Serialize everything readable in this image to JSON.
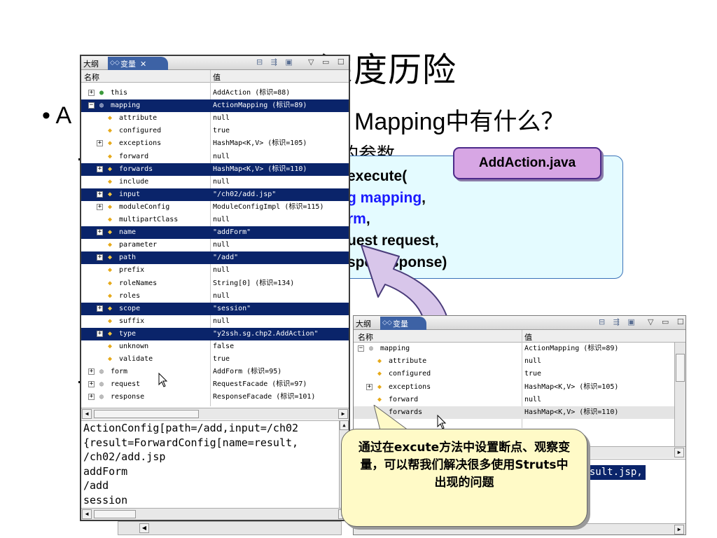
{
  "slide": {
    "title": "Struts深度历险",
    "bullet_prefix": "A",
    "bullet_tail": "Mapping中有什么？",
    "sub_fragment": "的参数",
    "code_filename": "AddAction.java",
    "code_lines": [
      {
        "text": "execute(",
        "blue": "",
        "after": ""
      },
      {
        "text": "",
        "blue": "g mapping",
        "after": ","
      },
      {
        "text": "",
        "blue": "rm",
        "after": ","
      },
      {
        "text": "uest request,",
        "blue": "",
        "after": ""
      },
      {
        "text": "sp",
        "blue": "",
        "after": "e response)"
      }
    ],
    "callout_text": "通过在excute方法中设置断点、观察变量，可以帮我们解决很多使用Struts中出现的问题"
  },
  "panel_main": {
    "tab_outline": "大纲",
    "tab_variables": "变量",
    "tab_close": "✕",
    "col_name": "名称",
    "col_value": "值",
    "rows": [
      {
        "exp": "+",
        "icon": "●",
        "icon_color": "green",
        "name": "this",
        "value": "AddAction  (标识=88)",
        "depth": 0,
        "sel": false
      },
      {
        "exp": "−",
        "icon": "◍",
        "icon_color": "grey",
        "name": "mapping",
        "value": "ActionMapping  (标识=89)",
        "depth": 0,
        "sel": true
      },
      {
        "exp": "",
        "icon": "◆",
        "icon_color": "dia",
        "name": "attribute",
        "value": "null",
        "depth": 2,
        "sel": false
      },
      {
        "exp": "",
        "icon": "◆",
        "icon_color": "dia",
        "name": "configured",
        "value": "true",
        "depth": 2,
        "sel": false
      },
      {
        "exp": "+",
        "icon": "◆",
        "icon_color": "dia",
        "name": "exceptions",
        "value": "HashMap<K,V>  (标识=105)",
        "depth": 1,
        "sel": false
      },
      {
        "exp": "",
        "icon": "◆",
        "icon_color": "dia",
        "name": "forward",
        "value": "null",
        "depth": 2,
        "sel": false
      },
      {
        "exp": "+",
        "icon": "◆",
        "icon_color": "dia",
        "name": "forwards",
        "value": "HashMap<K,V>  (标识=110)",
        "depth": 1,
        "sel": true
      },
      {
        "exp": "",
        "icon": "◆",
        "icon_color": "dia",
        "name": "include",
        "value": "null",
        "depth": 2,
        "sel": false
      },
      {
        "exp": "+",
        "icon": "◆",
        "icon_color": "dia",
        "name": "input",
        "value": "\"/ch02/add.jsp\"",
        "depth": 1,
        "sel": true
      },
      {
        "exp": "+",
        "icon": "◆",
        "icon_color": "dia",
        "name": "moduleConfig",
        "value": "ModuleConfigImpl  (标识=115)",
        "depth": 1,
        "sel": false
      },
      {
        "exp": "",
        "icon": "◆",
        "icon_color": "dia",
        "name": "multipartClass",
        "value": "null",
        "depth": 2,
        "sel": false
      },
      {
        "exp": "+",
        "icon": "◆",
        "icon_color": "dia",
        "name": "name",
        "value": "\"addForm\"",
        "depth": 1,
        "sel": true
      },
      {
        "exp": "",
        "icon": "◆",
        "icon_color": "dia",
        "name": "parameter",
        "value": "null",
        "depth": 2,
        "sel": false
      },
      {
        "exp": "+",
        "icon": "◆",
        "icon_color": "dia",
        "name": "path",
        "value": "\"/add\"",
        "depth": 1,
        "sel": true
      },
      {
        "exp": "",
        "icon": "◆",
        "icon_color": "dia",
        "name": "prefix",
        "value": "null",
        "depth": 2,
        "sel": false
      },
      {
        "exp": "",
        "icon": "◆",
        "icon_color": "dia",
        "name": "roleNames",
        "value": "String[0]  (标识=134)",
        "depth": 2,
        "sel": false
      },
      {
        "exp": "",
        "icon": "◆",
        "icon_color": "dia",
        "name": "roles",
        "value": "null",
        "depth": 2,
        "sel": false
      },
      {
        "exp": "+",
        "icon": "◆",
        "icon_color": "dia",
        "name": "scope",
        "value": "\"session\"",
        "depth": 1,
        "sel": true
      },
      {
        "exp": "",
        "icon": "◆",
        "icon_color": "dia",
        "name": "suffix",
        "value": "null",
        "depth": 2,
        "sel": false
      },
      {
        "exp": "+",
        "icon": "◆",
        "icon_color": "dia",
        "name": "type",
        "value": "\"y2ssh.sg.chp2.AddAction\"",
        "depth": 1,
        "sel": true
      },
      {
        "exp": "",
        "icon": "◆",
        "icon_color": "dia",
        "name": "unknown",
        "value": "false",
        "depth": 2,
        "sel": false
      },
      {
        "exp": "",
        "icon": "◆",
        "icon_color": "dia",
        "name": "validate",
        "value": "true",
        "depth": 2,
        "sel": false
      },
      {
        "exp": "+",
        "icon": "◍",
        "icon_color": "grey",
        "name": "form",
        "value": "AddForm  (标识=95)",
        "depth": 0,
        "sel": false
      },
      {
        "exp": "+",
        "icon": "◍",
        "icon_color": "grey",
        "name": "request",
        "value": "RequestFacade  (标识=97)",
        "depth": 0,
        "sel": false
      },
      {
        "exp": "+",
        "icon": "◍",
        "icon_color": "grey",
        "name": "response",
        "value": "ResponseFacade  (标识=101)",
        "depth": 0,
        "sel": false
      }
    ],
    "detail_text": "ActionConfig[path=/add,input=/ch02\n{result=ForwardConfig[name=result,\n/ch02/add.jsp\naddForm\n/add\nsession"
  },
  "panel_second": {
    "tab_outline": "大纲",
    "tab_variables": "变量",
    "col_name": "名称",
    "col_value": "值",
    "rows": [
      {
        "exp": "−",
        "icon": "◍",
        "icon_color": "grey",
        "name": "mapping",
        "value": "ActionMapping  (标识=89)",
        "depth": 0,
        "hl": false
      },
      {
        "exp": "",
        "icon": "◆",
        "icon_color": "dia",
        "name": "attribute",
        "value": "null",
        "depth": 2,
        "hl": false
      },
      {
        "exp": "",
        "icon": "◆",
        "icon_color": "dia",
        "name": "configured",
        "value": "true",
        "depth": 2,
        "hl": false
      },
      {
        "exp": "+",
        "icon": "◆",
        "icon_color": "dia",
        "name": "exceptions",
        "value": "HashMap<K,V>  (标识=105)",
        "depth": 1,
        "hl": false
      },
      {
        "exp": "",
        "icon": "◆",
        "icon_color": "dia",
        "name": "forward",
        "value": "null",
        "depth": 2,
        "hl": false
      },
      {
        "exp": "",
        "icon": "◆",
        "icon_color": "dia",
        "name": "forwards",
        "value": "HashMap<K,V>  (标识=110)",
        "depth": 2,
        "hl": true
      }
    ],
    "detail_fragment": "result.jsp,"
  }
}
